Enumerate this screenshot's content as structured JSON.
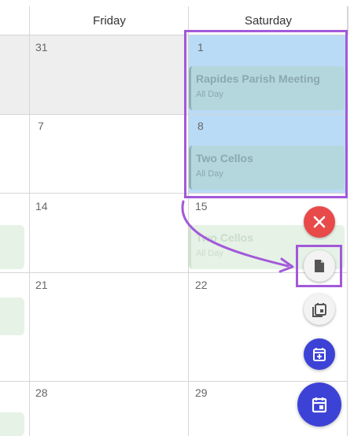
{
  "header": {
    "friday": "Friday",
    "saturday": "Saturday"
  },
  "weeks": [
    {
      "fri": "31",
      "sat": "1"
    },
    {
      "fri": "7",
      "sat": "8"
    },
    {
      "fri": "14",
      "sat": "15"
    },
    {
      "fri": "21",
      "sat": "22"
    },
    {
      "fri": "28",
      "sat": "29"
    }
  ],
  "events": [
    {
      "title": "Rapides Parish Meeting",
      "sub": "All Day"
    },
    {
      "title": "Two Cellos",
      "sub": "All Day"
    },
    {
      "title": "Two Cellos",
      "sub": "All Day"
    }
  ],
  "fabs": {
    "close": "close-icon",
    "note": "note-icon",
    "copy": "calendar-copy-icon",
    "add": "calendar-add-icon",
    "main": "calendar-icon"
  },
  "colors": {
    "selection": "#b9dbf6",
    "outline": "#a259d9",
    "fab_red": "#e84a4a",
    "fab_indigo": "#3d42d6"
  }
}
